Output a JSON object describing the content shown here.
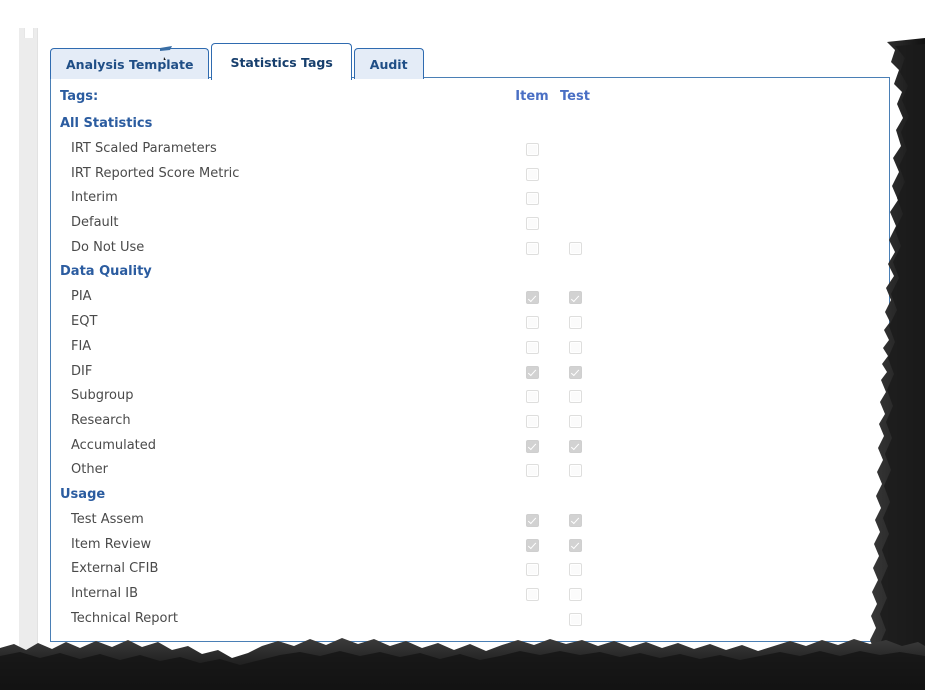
{
  "window": {
    "tabs": [
      {
        "label": "Analysis Template",
        "active": false
      },
      {
        "label": "Statistics Tags",
        "active": true
      },
      {
        "label": "Audit",
        "active": false
      }
    ]
  },
  "panel": {
    "headers": {
      "tags_label": "Tags:",
      "item_label": "Item",
      "test_label": "Test"
    },
    "groups": [
      {
        "name": "All Statistics",
        "rows": [
          {
            "label": "IRT Scaled Parameters",
            "item": "unchecked",
            "test": "none"
          },
          {
            "label": "IRT Reported Score Metric",
            "item": "unchecked",
            "test": "none"
          },
          {
            "label": "Interim",
            "item": "unchecked",
            "test": "none"
          },
          {
            "label": "Default",
            "item": "unchecked",
            "test": "none"
          },
          {
            "label": "Do Not Use",
            "item": "unchecked",
            "test": "unchecked"
          }
        ]
      },
      {
        "name": "Data Quality",
        "rows": [
          {
            "label": "PIA",
            "item": "checked",
            "test": "checked"
          },
          {
            "label": "EQT",
            "item": "unchecked",
            "test": "unchecked"
          },
          {
            "label": "FIA",
            "item": "unchecked",
            "test": "unchecked"
          },
          {
            "label": "DIF",
            "item": "checked",
            "test": "checked"
          },
          {
            "label": "Subgroup",
            "item": "unchecked",
            "test": "unchecked"
          },
          {
            "label": "Research",
            "item": "unchecked",
            "test": "unchecked"
          },
          {
            "label": "Accumulated",
            "item": "checked",
            "test": "checked"
          },
          {
            "label": "Other",
            "item": "unchecked",
            "test": "unchecked"
          }
        ]
      },
      {
        "name": "Usage",
        "rows": [
          {
            "label": "Test Assem",
            "item": "checked",
            "test": "checked"
          },
          {
            "label": "Item Review",
            "item": "checked",
            "test": "checked"
          },
          {
            "label": "External CFIB",
            "item": "unchecked",
            "test": "unchecked"
          },
          {
            "label": "Internal IB",
            "item": "unchecked",
            "test": "unchecked"
          },
          {
            "label": "Technical Report",
            "item": "none",
            "test": "unchecked"
          }
        ]
      }
    ]
  },
  "colors": {
    "tab_border": "#2f6bb0",
    "tab_inactive_bg": "#e4ecf7",
    "tab_text": "#1f4e86",
    "panel_border": "#4a7fb5",
    "heading_text": "#2b5ca0",
    "column_header_text": "#4a6fc4",
    "row_text": "#4a4a4a",
    "checkbox_checked_bg": "#d2d2d2",
    "checkbox_unchecked_bg": "#fbfbfb",
    "page_edge_gray": "#ececec"
  }
}
